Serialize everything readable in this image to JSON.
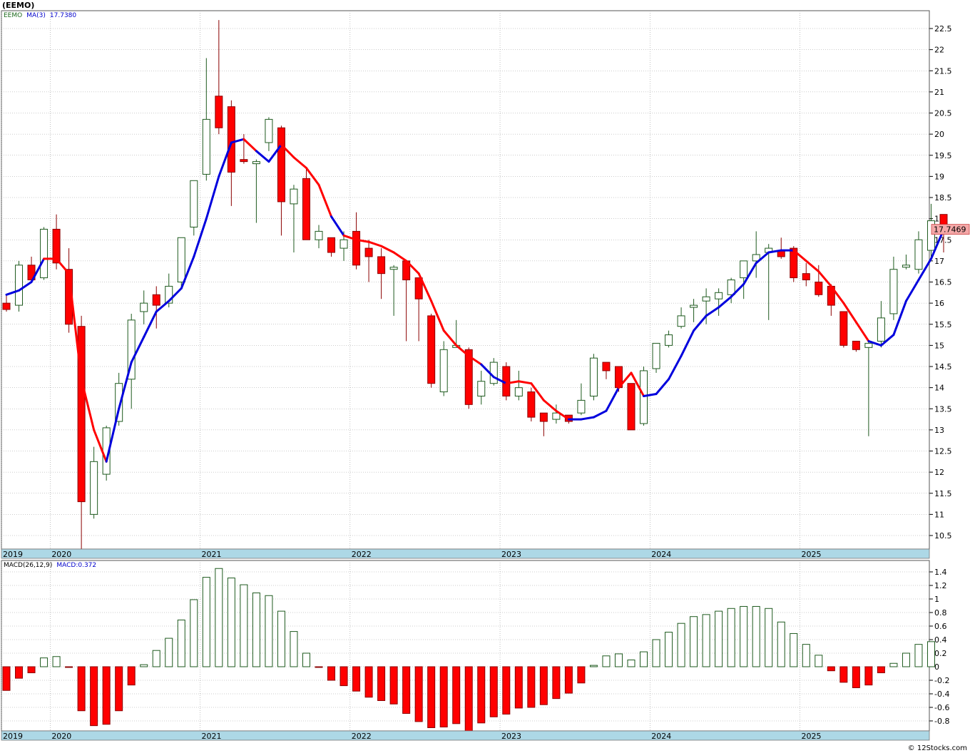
{
  "title": "(EEMO)",
  "watermark": "© 12Stocks.com",
  "colors": {
    "up_fill": "#ffffff",
    "up_stroke": "#1e5a1e",
    "down_fill": "#ff0000",
    "ma_up": "#0000dd",
    "ma_down": "#ff0000",
    "axis_band": "#add8e6",
    "grid": "#9a9a9a",
    "price_box": "#f4a8a8"
  },
  "chart_data": [
    {
      "type": "candlestick",
      "legend": {
        "symbol": "EEMO",
        "ma_label": "MA(3)",
        "ma_value": "17.7380"
      },
      "ylim": [
        10.0,
        22.9
      ],
      "ytick_labels": [
        "22.5000",
        "22.0000",
        "21.5000",
        "21.0000",
        "20.5000",
        "20.0000",
        "19.5000",
        "19.0000",
        "18.5000",
        "18.0000",
        "17.5000",
        "17.0000",
        "16.5000",
        "16.0000",
        "15.5000",
        "15.0000",
        "14.5000",
        "14.0000",
        "13.5000",
        "13.0000",
        "12.5000",
        "12.0000",
        "11.5000",
        "11.0000",
        "10.5000"
      ],
      "ytick_values": [
        22.5,
        22.0,
        21.5,
        21.0,
        20.5,
        20.0,
        19.5,
        19.0,
        18.5,
        18.0,
        17.5,
        17.0,
        16.5,
        16.0,
        15.5,
        15.0,
        14.5,
        14.0,
        13.5,
        13.0,
        12.5,
        12.0,
        11.5,
        11.0,
        10.5
      ],
      "last_price": "17.7469",
      "last_price_value": 17.7469,
      "year_labels": [
        "2019",
        "2020",
        "2021",
        "2022",
        "2023",
        "2024",
        "2025"
      ],
      "year_positions": [
        0,
        4,
        16,
        28,
        40,
        52,
        64
      ],
      "candles": [
        [
          16.0,
          16.2,
          15.8,
          15.85
        ],
        [
          15.95,
          17.0,
          15.8,
          16.9
        ],
        [
          16.9,
          17.1,
          16.5,
          16.55
        ],
        [
          16.6,
          17.8,
          16.55,
          17.75
        ],
        [
          17.75,
          18.1,
          16.8,
          16.95
        ],
        [
          16.8,
          17.3,
          15.3,
          15.5
        ],
        [
          15.45,
          15.7,
          10.0,
          11.3
        ],
        [
          11.0,
          12.6,
          10.9,
          12.25
        ],
        [
          11.95,
          13.1,
          11.8,
          13.05
        ],
        [
          13.2,
          14.35,
          13.1,
          14.1
        ],
        [
          14.2,
          15.75,
          13.5,
          15.6
        ],
        [
          15.8,
          16.3,
          15.5,
          16.0
        ],
        [
          16.2,
          16.4,
          15.4,
          15.95
        ],
        [
          16.0,
          16.7,
          15.9,
          16.4
        ],
        [
          16.5,
          17.5,
          16.4,
          17.55
        ],
        [
          17.8,
          18.9,
          17.6,
          18.9
        ],
        [
          19.05,
          21.8,
          18.9,
          20.35
        ],
        [
          20.9,
          22.7,
          20.0,
          20.15
        ],
        [
          20.65,
          20.8,
          18.3,
          19.1
        ],
        [
          19.4,
          20.0,
          19.3,
          19.35
        ],
        [
          19.3,
          19.4,
          17.9,
          19.35
        ],
        [
          19.8,
          20.4,
          19.6,
          20.35
        ],
        [
          20.15,
          20.2,
          17.6,
          18.4
        ],
        [
          18.35,
          18.8,
          17.2,
          18.7
        ],
        [
          18.95,
          19.2,
          17.5,
          17.5
        ],
        [
          17.5,
          17.85,
          17.3,
          17.7
        ],
        [
          17.55,
          17.55,
          17.1,
          17.2
        ],
        [
          17.3,
          17.7,
          17.0,
          17.5
        ],
        [
          17.7,
          18.15,
          16.8,
          16.9
        ],
        [
          17.3,
          17.5,
          16.5,
          17.1
        ],
        [
          17.1,
          17.3,
          16.1,
          16.7
        ],
        [
          16.8,
          16.9,
          15.7,
          16.85
        ],
        [
          17.0,
          17.0,
          15.1,
          16.55
        ],
        [
          16.6,
          16.6,
          15.1,
          16.1
        ],
        [
          15.7,
          15.75,
          14.0,
          14.1
        ],
        [
          13.9,
          15.1,
          13.8,
          14.9
        ],
        [
          14.95,
          15.6,
          14.95,
          15.0
        ],
        [
          14.9,
          14.95,
          13.5,
          13.6
        ],
        [
          13.8,
          14.4,
          13.6,
          14.15
        ],
        [
          14.1,
          14.7,
          14.05,
          14.6
        ],
        [
          14.5,
          14.6,
          13.7,
          13.8
        ],
        [
          13.8,
          14.4,
          13.7,
          14.0
        ],
        [
          13.9,
          14.0,
          13.2,
          13.3
        ],
        [
          13.4,
          13.4,
          12.85,
          13.2
        ],
        [
          13.25,
          13.6,
          13.15,
          13.4
        ],
        [
          13.35,
          13.35,
          13.15,
          13.2
        ],
        [
          13.4,
          14.1,
          13.35,
          13.7
        ],
        [
          13.8,
          14.8,
          13.7,
          14.7
        ],
        [
          14.6,
          14.6,
          14.2,
          14.4
        ],
        [
          14.5,
          14.5,
          13.9,
          14.0
        ],
        [
          14.1,
          14.1,
          13.0,
          13.0
        ],
        [
          13.15,
          14.5,
          13.1,
          14.4
        ],
        [
          14.45,
          15.05,
          14.35,
          15.05
        ],
        [
          15.0,
          15.35,
          14.95,
          15.25
        ],
        [
          15.45,
          15.9,
          15.4,
          15.7
        ],
        [
          15.9,
          16.1,
          15.55,
          15.95
        ],
        [
          16.05,
          16.35,
          15.5,
          16.15
        ],
        [
          16.1,
          16.35,
          15.7,
          16.25
        ],
        [
          16.2,
          16.6,
          16.0,
          16.55
        ],
        [
          16.6,
          17.0,
          16.1,
          17.0
        ],
        [
          17.0,
          17.7,
          16.6,
          17.15
        ],
        [
          17.2,
          17.4,
          15.6,
          17.3
        ],
        [
          17.25,
          17.55,
          17.05,
          17.1
        ],
        [
          17.3,
          17.35,
          16.5,
          16.6
        ],
        [
          16.7,
          16.95,
          16.4,
          16.55
        ],
        [
          16.5,
          16.9,
          16.15,
          16.2
        ],
        [
          16.4,
          16.45,
          15.7,
          15.95
        ],
        [
          15.8,
          15.8,
          14.95,
          15.0
        ],
        [
          15.1,
          15.1,
          14.85,
          14.9
        ],
        [
          14.95,
          15.1,
          12.85,
          15.05
        ],
        [
          15.1,
          16.05,
          14.95,
          15.65
        ],
        [
          15.75,
          17.1,
          15.6,
          16.8
        ],
        [
          16.85,
          17.15,
          16.8,
          16.9
        ],
        [
          16.8,
          17.7,
          16.7,
          17.5
        ],
        [
          17.25,
          18.35,
          17.0,
          17.95
        ],
        [
          18.1,
          18.1,
          17.2,
          17.75
        ]
      ],
      "ma": [
        16.2,
        16.3,
        16.5,
        17.05,
        17.05,
        16.7,
        14.2,
        13.0,
        12.25,
        13.5,
        14.6,
        15.2,
        15.8,
        16.05,
        16.35,
        17.1,
        18.0,
        19.0,
        19.8,
        19.88,
        19.6,
        19.35,
        19.75,
        19.45,
        19.2,
        18.8,
        18.05,
        17.6,
        17.5,
        17.45,
        17.35,
        17.2,
        17.0,
        16.7,
        16.05,
        15.35,
        15.0,
        14.75,
        14.55,
        14.25,
        14.1,
        14.15,
        14.1,
        13.7,
        13.45,
        13.25,
        13.25,
        13.3,
        13.45,
        14.0,
        14.35,
        13.8,
        13.85,
        14.2,
        14.75,
        15.35,
        15.7,
        15.9,
        16.15,
        16.45,
        16.95,
        17.2,
        17.25,
        17.25,
        17.0,
        16.75,
        16.4,
        16.0,
        15.55,
        15.1,
        15.0,
        15.25,
        16.05,
        16.55,
        17.05,
        17.74
      ],
      "ma_direction": [
        1,
        1,
        1,
        1,
        0,
        0,
        0,
        0,
        0,
        1,
        1,
        1,
        1,
        1,
        1,
        1,
        1,
        1,
        1,
        1,
        0,
        1,
        1,
        0,
        0,
        0,
        0,
        1,
        0,
        0,
        0,
        0,
        0,
        0,
        0,
        0,
        0,
        0,
        0,
        1,
        1,
        0,
        0,
        0,
        0,
        0,
        1,
        1,
        1,
        1,
        0,
        0,
        1,
        1,
        1,
        1,
        1,
        1,
        1,
        1,
        1,
        1,
        1,
        1,
        0,
        0,
        0,
        0,
        0,
        0,
        1,
        1,
        1,
        1,
        1,
        1
      ]
    },
    {
      "type": "bar",
      "legend": {
        "label": "MACD(26,12,9)",
        "value_label": "MACD:0.372"
      },
      "ylim": [
        -0.98,
        1.52
      ],
      "ytick_labels": [
        "1.400",
        "1.200",
        "1.000",
        "0.800",
        "0.600",
        "0.400",
        "0.200",
        "0.000",
        "-0.200",
        "-0.400",
        "-0.600",
        "-0.800"
      ],
      "ytick_values": [
        1.4,
        1.2,
        1.0,
        0.8,
        0.6,
        0.4,
        0.2,
        0.0,
        -0.2,
        -0.4,
        -0.6,
        -0.8
      ],
      "year_labels": [
        "2019",
        "2020",
        "2021",
        "2022",
        "2023",
        "2024",
        "2025"
      ],
      "values": [
        -0.35,
        -0.17,
        -0.09,
        0.13,
        0.15,
        -0.01,
        -0.65,
        -0.87,
        -0.85,
        -0.65,
        -0.27,
        0.03,
        0.24,
        0.42,
        0.69,
        0.99,
        1.32,
        1.45,
        1.31,
        1.21,
        1.09,
        1.05,
        0.82,
        0.52,
        0.2,
        -0.01,
        -0.2,
        -0.28,
        -0.36,
        -0.45,
        -0.5,
        -0.55,
        -0.69,
        -0.81,
        -0.9,
        -0.89,
        -0.84,
        -0.95,
        -0.83,
        -0.74,
        -0.7,
        -0.61,
        -0.6,
        -0.56,
        -0.47,
        -0.39,
        -0.24,
        0.02,
        0.16,
        0.19,
        0.1,
        0.22,
        0.4,
        0.51,
        0.64,
        0.74,
        0.77,
        0.82,
        0.86,
        0.89,
        0.89,
        0.86,
        0.66,
        0.49,
        0.33,
        0.17,
        -0.06,
        -0.23,
        -0.31,
        -0.27,
        -0.09,
        0.05,
        0.2,
        0.33,
        0.37
      ]
    }
  ]
}
